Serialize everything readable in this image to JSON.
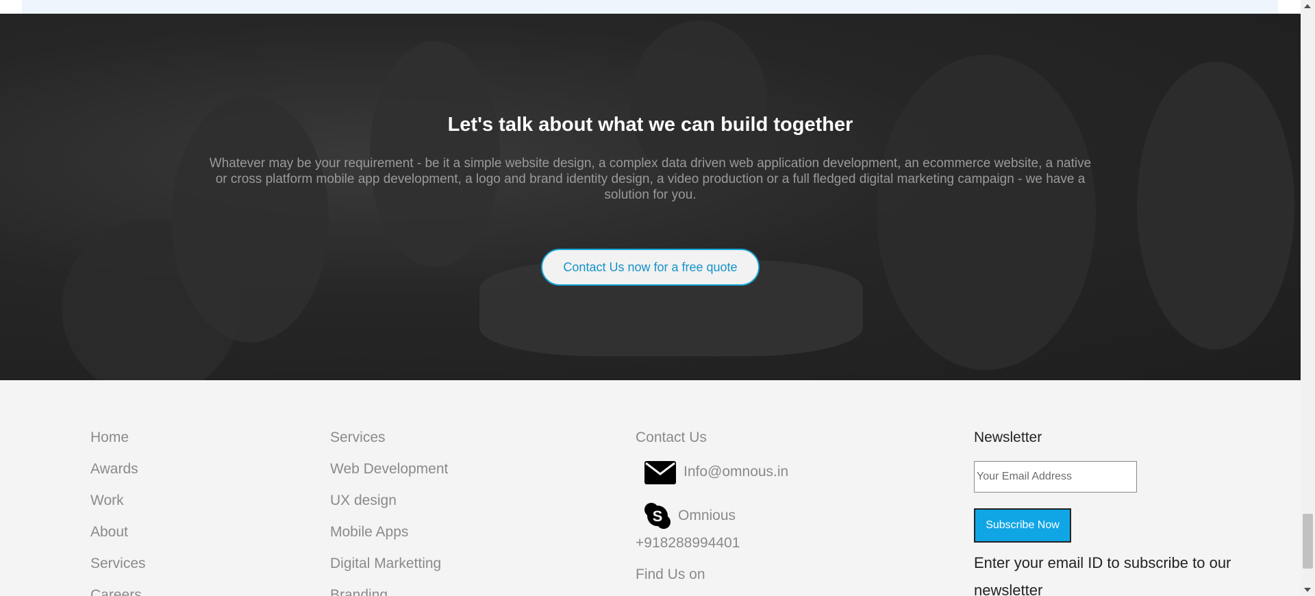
{
  "hero": {
    "title": "Let's talk about what we can build together",
    "text": "Whatever may be your requirement - be it a simple website design, a complex data driven web application development, an ecommerce website, a native or cross platform mobile app development, a logo and brand identity design, a video production or a full fledged digital marketing campaign - we have a solution for you.",
    "cta_label": "Contact Us now for a free quote",
    "accent_color": "#16a3d6"
  },
  "footer": {
    "nav": [
      "Home",
      "Awards",
      "Work",
      "About",
      "Services",
      "Careers"
    ],
    "services": [
      "Services",
      "Web Development",
      "UX design",
      "Mobile Apps",
      "Digital Marketting",
      "Branding"
    ],
    "contact": {
      "heading": "Contact Us",
      "email": "Info@omnous.in",
      "email_icon": "envelope-icon",
      "skype": "Omnious",
      "skype_icon": "skype-icon",
      "phone": "+918288994401",
      "find_us": "Find Us on"
    },
    "newsletter": {
      "heading": "Newsletter",
      "placeholder": "Your Email Address",
      "button_label": "Subscribe Now",
      "button_color": "#10a6e6",
      "description": "Enter your email ID to subscribe to our newsletter"
    }
  }
}
